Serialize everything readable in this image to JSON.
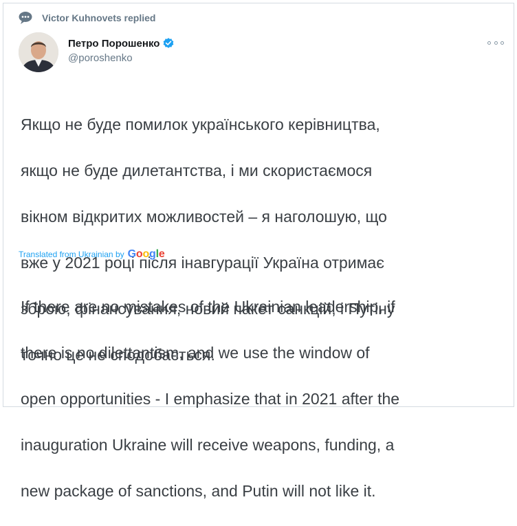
{
  "context": {
    "icon": "speech-bubble-icon",
    "text": "Victor Kuhnovets replied"
  },
  "author": {
    "display_name": "Петро Порошенко",
    "handle": "@poroshenko",
    "verified_icon": "verified-badge-icon",
    "avatar_icon": "avatar"
  },
  "more_icon": "more-options-icon",
  "tweet": {
    "lines": [
      "Якщо не буде помилок українського керівництва,",
      "якщо не буде дилетантства, і ми скористаємося",
      "вікном відкритих можливостей – я наголошую, що",
      "вже у 2021 році після інавгурації Україна отримає",
      "зброю, фінансування, новий пакет санкцій, і Путіну",
      "точно це не сподобається."
    ]
  },
  "translation_notice": {
    "text": "Translated from Ukrainian by",
    "provider_letters": [
      "G",
      "o",
      "o",
      "g",
      "l",
      "e"
    ]
  },
  "translation": {
    "lines": [
      "If there are no mistakes of the Ukrainian leadership, if",
      "there is no dilettantism, and we use the window of",
      "open opportunities - I emphasize that in 2021 after the",
      "inauguration Ukraine will receive weapons, funding, a",
      "new package of sanctions, and Putin will not like it."
    ]
  },
  "colors": {
    "link_blue": "#1da1f2",
    "secondary_text": "#657786",
    "body_text": "#3a3f44",
    "verified_blue": "#1da1f2"
  }
}
